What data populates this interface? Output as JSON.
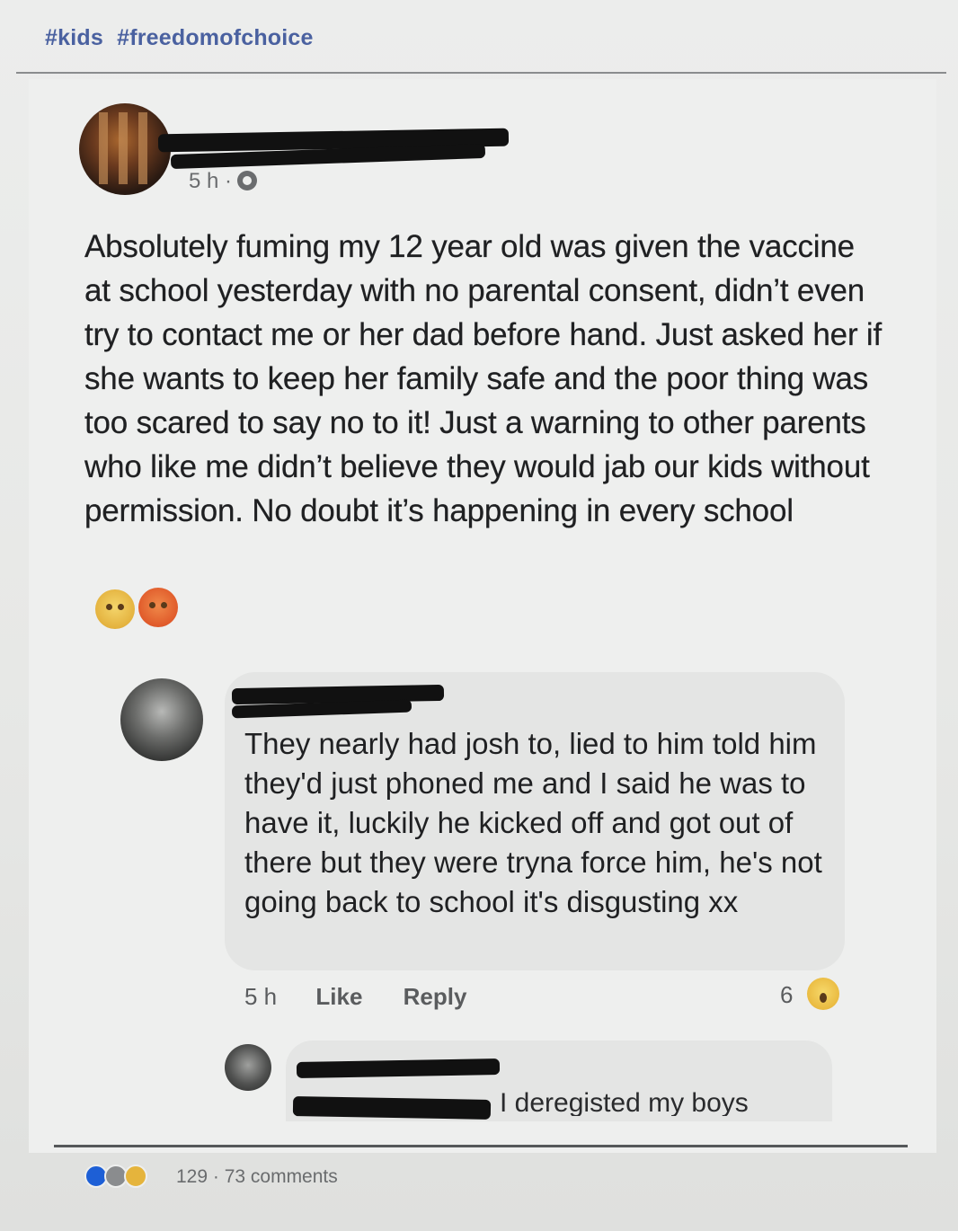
{
  "header": {
    "hashtags": [
      "#kids",
      "#freedomofchoice"
    ]
  },
  "post": {
    "time": "5 h ·",
    "text": "Absolutely fuming my 12 year old was given the vaccine at school yesterday with no parental consent, didn’t even try to contact me or her dad before hand. Just asked her if she wants to keep her family safe and the poor thing was too scared to say no to it! Just a warning to other parents who like me didn’t believe they would jab our kids without permission. No doubt it’s happening in every school",
    "emojis": [
      "crying-face",
      "angry-face"
    ]
  },
  "comment": {
    "text": "They nearly had josh to, lied to him told him they'd just phoned me and I said he was to have it, luckily he kicked off and got out of there but they were tryna force him, he's not going back to school it's disgusting xx",
    "time": "5 h",
    "like_label": "Like",
    "reply_label": "Reply",
    "reaction_count": "6",
    "reaction_icon": "wow-icon"
  },
  "reply": {
    "text": "I deregisted my boys"
  },
  "footer": {
    "stats": "129 · 73 comments",
    "reaction_icons": [
      "like-icon",
      "sad-icon",
      "care-icon"
    ]
  },
  "colors": {
    "hashtag": "#4a61a0",
    "text": "#1f2022",
    "meta": "#6a6c6e"
  }
}
